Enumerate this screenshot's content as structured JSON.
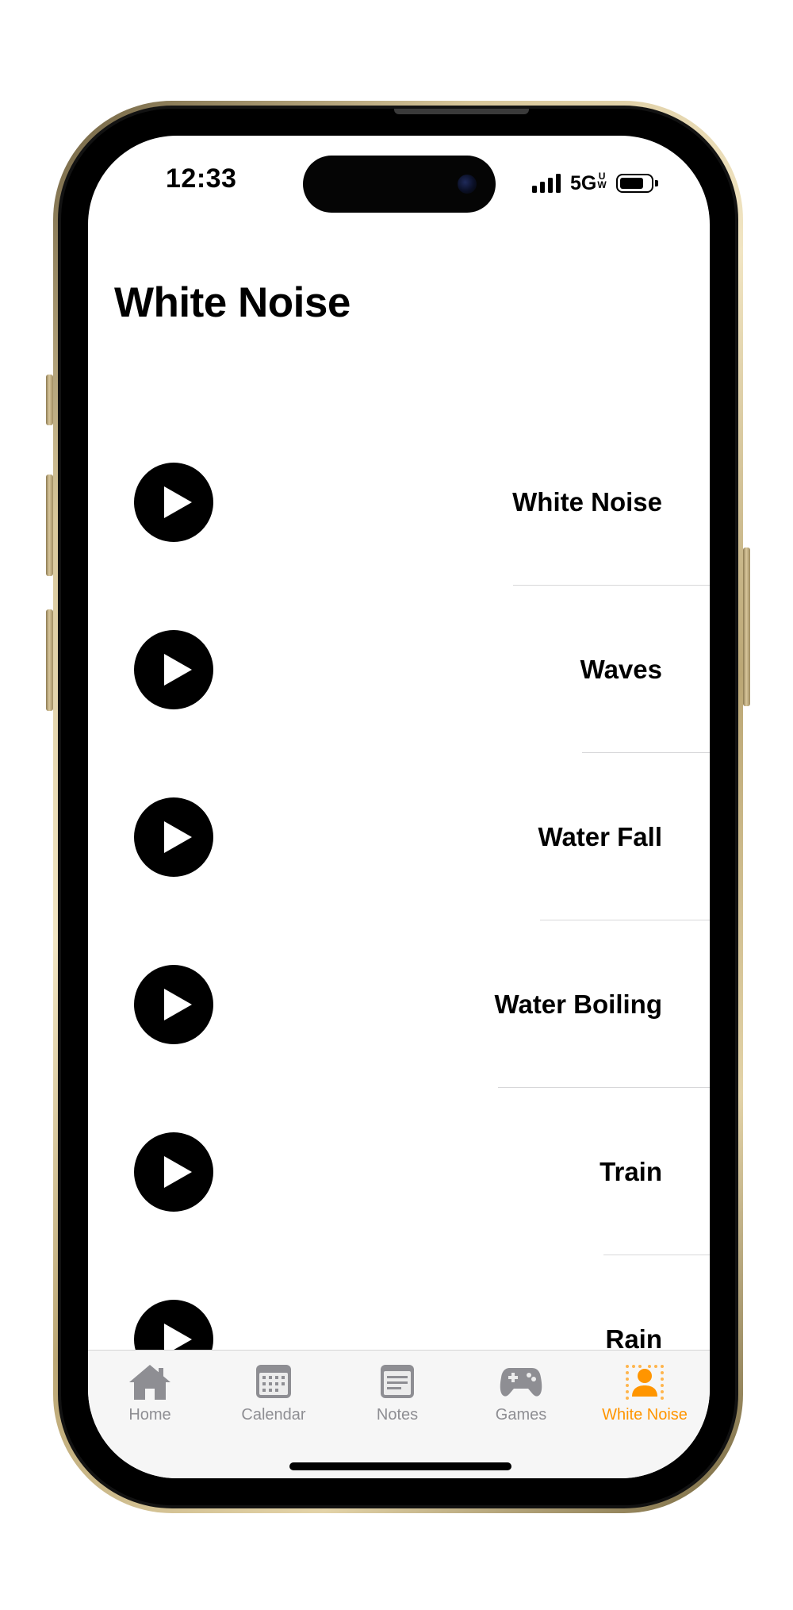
{
  "status_bar": {
    "time": "12:33",
    "network": "5G",
    "network_sup_top": "U",
    "network_sup_bottom": "W"
  },
  "header": {
    "title": "White Noise"
  },
  "sounds": [
    {
      "label": "White Noise"
    },
    {
      "label": "Waves"
    },
    {
      "label": "Water Fall"
    },
    {
      "label": "Water Boiling"
    },
    {
      "label": "Train"
    },
    {
      "label": "Rain"
    }
  ],
  "tab_bar": {
    "active_color": "#ff9500",
    "inactive_color": "#8e8e93",
    "active_tab": "White Noise",
    "tabs": [
      {
        "label": "Home",
        "icon": "house-icon"
      },
      {
        "label": "Calendar",
        "icon": "calendar-icon"
      },
      {
        "label": "Notes",
        "icon": "notes-icon"
      },
      {
        "label": "Games",
        "icon": "gamecontroller-icon"
      },
      {
        "label": "White Noise",
        "icon": "person-dotted-icon"
      }
    ]
  }
}
